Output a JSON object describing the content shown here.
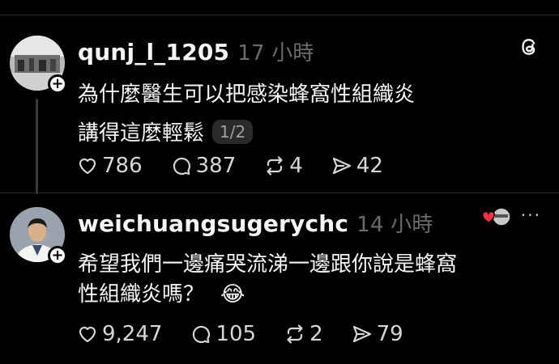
{
  "app": {
    "logo_icon": "threads-logo-icon"
  },
  "posts": [
    {
      "username": "qunj_l_1205",
      "time": "17 小時",
      "text_line1": "為什麼醫生可以把感染蜂窩性組織炎",
      "text_line2": "講得這麼輕鬆",
      "page_counter": "1/2",
      "likes": "786",
      "comments": "387",
      "reposts": "4",
      "shares": "42"
    },
    {
      "username": "weichuangsugerychc",
      "time": "14 小時",
      "text_line1": "希望我們一邊痛哭流涕一邊跟你說是蜂窩",
      "text_line2": "性組織炎嗎？",
      "emoji": "😂",
      "more_label": "···",
      "likes": "9,247",
      "comments": "105",
      "reposts": "2",
      "shares": "79"
    }
  ],
  "colors": {
    "background": "#000000",
    "text": "#f3f5f7",
    "muted": "#6b6b6b",
    "like_heart": "#ff3040"
  }
}
